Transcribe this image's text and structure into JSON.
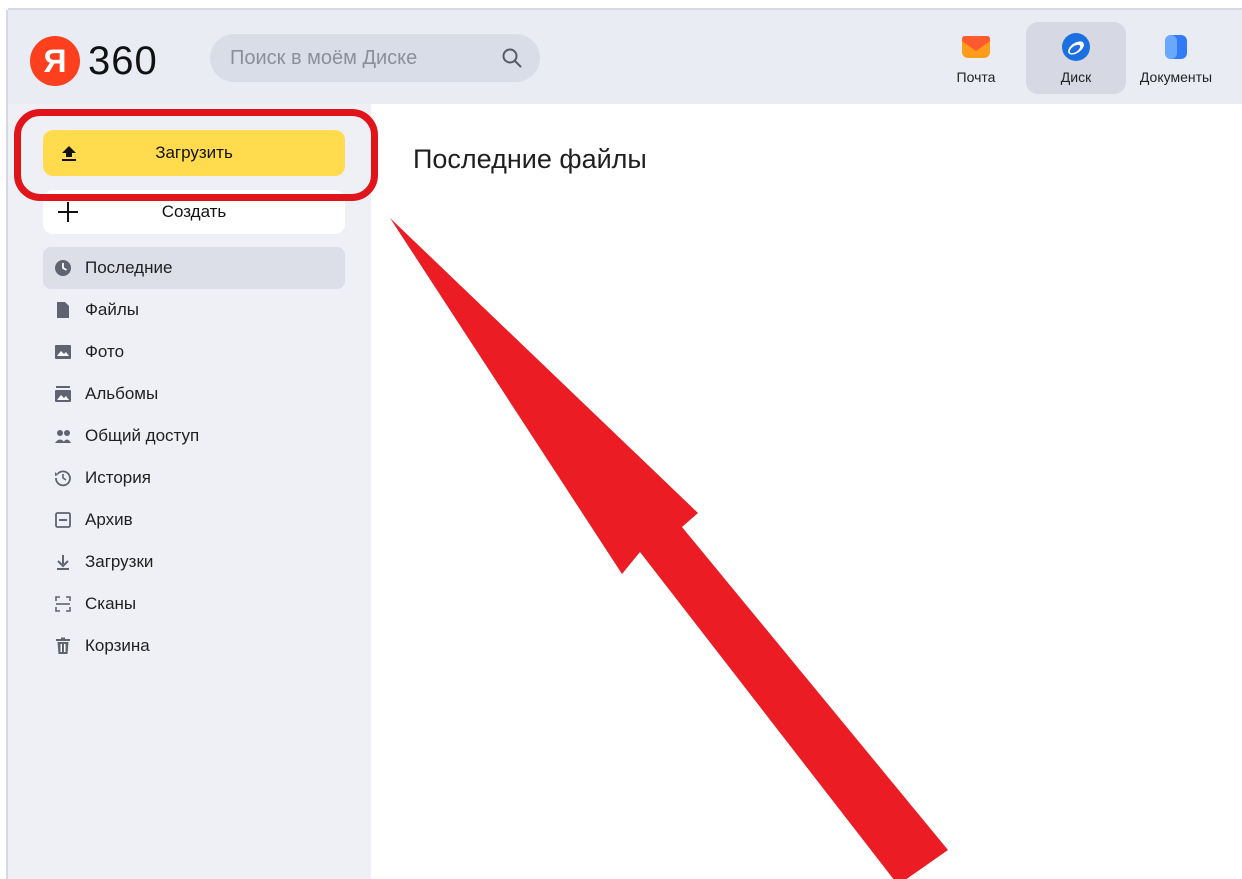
{
  "app": {
    "logo_letter": "Я",
    "logo_text": "360"
  },
  "search": {
    "placeholder": "Поиск в моём Диске"
  },
  "apps": [
    {
      "label": "Почта",
      "icon": "mail-icon"
    },
    {
      "label": "Диск",
      "icon": "disk-icon",
      "active": true
    },
    {
      "label": "Документы",
      "icon": "documents-icon"
    }
  ],
  "sidebar": {
    "upload_label": "Загрузить",
    "create_label": "Создать",
    "items": [
      {
        "label": "Последние",
        "icon": "clock-icon",
        "active": true
      },
      {
        "label": "Файлы",
        "icon": "file-icon"
      },
      {
        "label": "Фото",
        "icon": "photo-icon"
      },
      {
        "label": "Альбомы",
        "icon": "albums-icon"
      },
      {
        "label": "Общий доступ",
        "icon": "shared-icon"
      },
      {
        "label": "История",
        "icon": "history-icon"
      },
      {
        "label": "Архив",
        "icon": "archive-icon"
      },
      {
        "label": "Загрузки",
        "icon": "downloads-icon"
      },
      {
        "label": "Сканы",
        "icon": "scan-icon"
      },
      {
        "label": "Корзина",
        "icon": "trash-icon"
      }
    ]
  },
  "main": {
    "title": "Последние файлы"
  },
  "colors": {
    "accent_yellow": "#ffdb4d",
    "annotation_red": "#e0141b",
    "logo_red": "#fc3f1d"
  }
}
